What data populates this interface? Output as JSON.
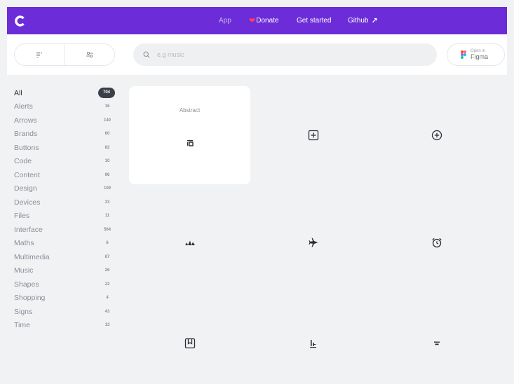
{
  "nav": {
    "app": "App",
    "donate": "Donate",
    "get_started": "Get started",
    "github": "Github"
  },
  "search": {
    "placeholder": "e.g music"
  },
  "figma": {
    "small": "Open in",
    "big": "Figma"
  },
  "categories": [
    {
      "label": "All",
      "count": "704"
    },
    {
      "label": "Alerts",
      "count": "16"
    },
    {
      "label": "Arrows",
      "count": "140"
    },
    {
      "label": "Brands",
      "count": "60"
    },
    {
      "label": "Buttons",
      "count": "82"
    },
    {
      "label": "Code",
      "count": "10"
    },
    {
      "label": "Content",
      "count": "96"
    },
    {
      "label": "Design",
      "count": "109"
    },
    {
      "label": "Devices",
      "count": "33"
    },
    {
      "label": "Files",
      "count": "11"
    },
    {
      "label": "Interface",
      "count": "564"
    },
    {
      "label": "Maths",
      "count": "6"
    },
    {
      "label": "Multimedia",
      "count": "67"
    },
    {
      "label": "Music",
      "count": "26"
    },
    {
      "label": "Shapes",
      "count": "22"
    },
    {
      "label": "Shopping",
      "count": "4"
    },
    {
      "label": "Signs",
      "count": "43"
    },
    {
      "label": "Time",
      "count": "13"
    }
  ],
  "icons": [
    {
      "name": "abstract-icon",
      "label": "Abstract"
    },
    {
      "name": "add-box-icon"
    },
    {
      "name": "add-circle-icon"
    },
    {
      "name": "adidas-icon"
    },
    {
      "name": "airplane-icon"
    },
    {
      "name": "alarm-icon"
    },
    {
      "name": "album-icon"
    },
    {
      "name": "align-bottom-icon"
    },
    {
      "name": "align-center-icon"
    }
  ],
  "colors": {
    "accent": "#6c2cd8",
    "active_badge": "#3b3f47"
  }
}
